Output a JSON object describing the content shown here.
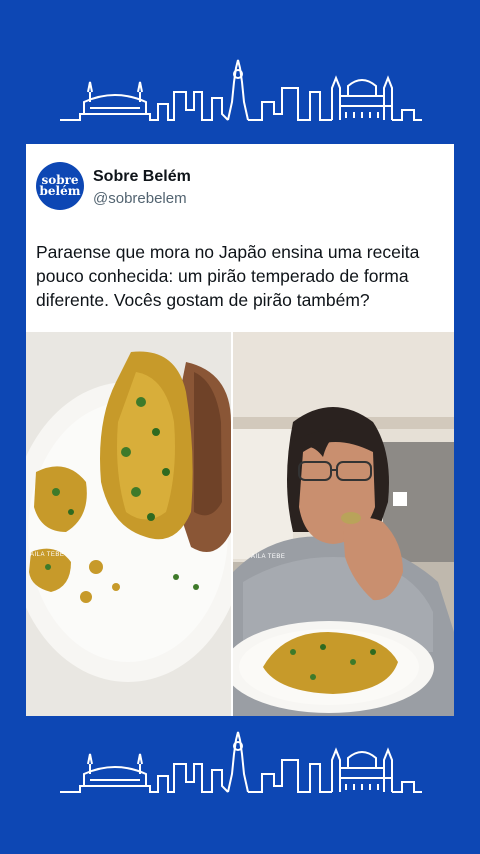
{
  "account": {
    "avatar_line1": "sobre",
    "avatar_line2": "belém",
    "name": "Sobre Belém",
    "handle": "@sobrebelem"
  },
  "post": {
    "lines": [
      "Paraense que mora no Japão ensina uma receita",
      "pouco conhecida: um pirão temperado de forma",
      "diferente. Vocês gostam de pirão também?"
    ]
  },
  "media": {
    "left_watermark": "AILA TEBE",
    "right_watermark": "AILA TEBE"
  },
  "colors": {
    "background": "#0d47b4",
    "card": "#ffffff",
    "skyline": "#ffffff"
  }
}
